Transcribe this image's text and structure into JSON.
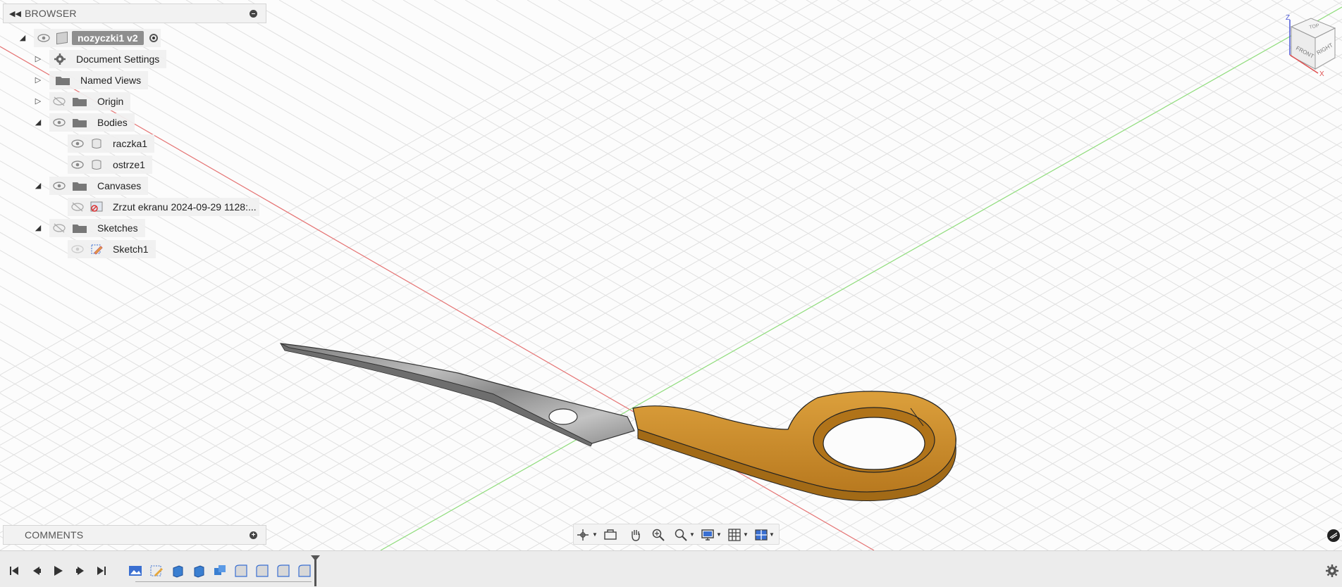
{
  "browser": {
    "title": "BROWSER",
    "root": "nozyczki1 v2",
    "items": [
      {
        "label": "Document Settings"
      },
      {
        "label": "Named Views"
      },
      {
        "label": "Origin"
      },
      {
        "label": "Bodies"
      },
      {
        "label": "raczka1"
      },
      {
        "label": "ostrze1"
      },
      {
        "label": "Canvases"
      },
      {
        "label": "Zrzut ekranu 2024-09-29 1128:..."
      },
      {
        "label": "Sketches"
      },
      {
        "label": "Sketch1"
      }
    ]
  },
  "comments": {
    "title": "COMMENTS"
  },
  "viewcube": {
    "faces": [
      "TOP",
      "FRONT",
      "RIGHT"
    ],
    "axes": [
      "Z",
      "X"
    ]
  },
  "colors": {
    "handle": "#c98a2a",
    "blade": "#9a9a9a",
    "axis_red": "#e36a6a",
    "axis_green": "#7fd36b",
    "grid": "#dcdcdc"
  }
}
